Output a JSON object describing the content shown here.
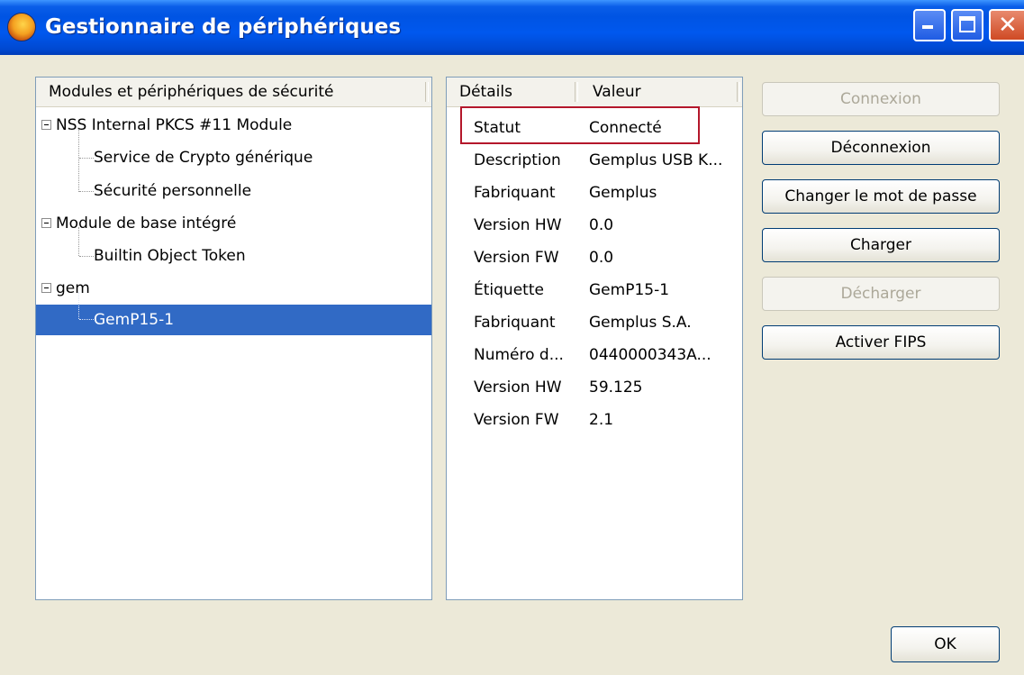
{
  "window": {
    "title": "Gestionnaire de périphériques"
  },
  "tree": {
    "header": "Modules et périphériques de sécurité",
    "items": [
      {
        "label": "NSS Internal PKCS #11 Module",
        "level": 0,
        "expanded": true
      },
      {
        "label": "Service de Crypto générique",
        "level": 1
      },
      {
        "label": "Sécurité personnelle",
        "level": 1
      },
      {
        "label": "Module de base intégré",
        "level": 0,
        "expanded": true
      },
      {
        "label": "Builtin Object Token",
        "level": 1
      },
      {
        "label": "gem",
        "level": 0,
        "expanded": true
      },
      {
        "label": "GemP15-1",
        "level": 1,
        "selected": true
      }
    ]
  },
  "details": {
    "header_key": "Détails",
    "header_value": "Valeur",
    "rows": [
      {
        "key": "Statut",
        "value": "Connecté"
      },
      {
        "key": "Description",
        "value": "Gemplus USB K..."
      },
      {
        "key": "Fabriquant",
        "value": "Gemplus"
      },
      {
        "key": "Version HW",
        "value": "0.0"
      },
      {
        "key": "Version FW",
        "value": "0.0"
      },
      {
        "key": "Étiquette",
        "value": "GemP15-1"
      },
      {
        "key": "Fabriquant",
        "value": "Gemplus S.A."
      },
      {
        "key": "Numéro d...",
        "value": "0440000343A..."
      },
      {
        "key": "Version HW",
        "value": "59.125"
      },
      {
        "key": "Version FW",
        "value": "2.1"
      }
    ]
  },
  "buttons": {
    "connexion": "Connexion",
    "deconnexion": "Déconnexion",
    "changer_mdp": "Changer le mot de passe",
    "charger": "Charger",
    "decharger": "Décharger",
    "activer_fips": "Activer FIPS",
    "ok": "OK"
  },
  "colors": {
    "titlebar": "#0054e3",
    "selection": "#316ac5",
    "highlight_box": "#b4172b"
  }
}
